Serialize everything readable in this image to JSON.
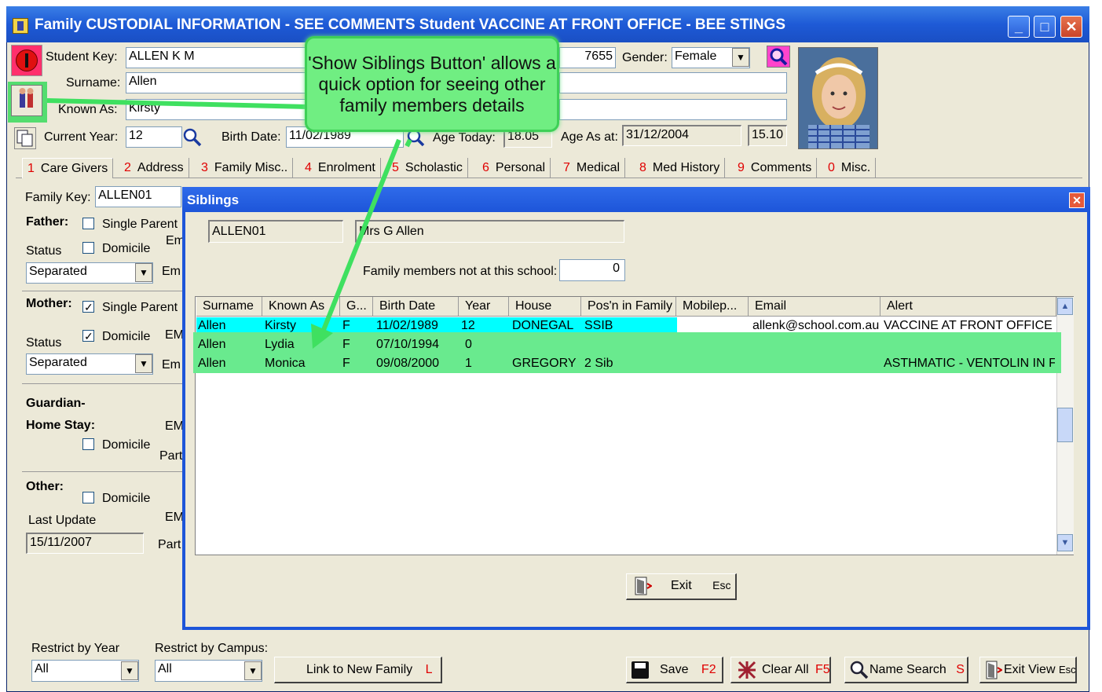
{
  "window": {
    "title": "Family CUSTODIAL INFORMATION - SEE COMMENTS Student VACCINE AT FRONT OFFICE - BEE STINGS",
    "minimize": "_",
    "maximize": "□",
    "close": "✕"
  },
  "student": {
    "student_key_label": "Student Key:",
    "student_key": "ALLEN K M",
    "id_number": "7655",
    "gender_label": "Gender:",
    "gender": "Female",
    "surname_label": "Surname:",
    "surname": "Allen",
    "known_as_label": "Known As:",
    "known_as": "Kirsty",
    "current_year_label": "Current Year:",
    "current_year": "12",
    "birth_date_label": "Birth Date:",
    "birth_date": "11/02/1989",
    "age_today_label": "Age Today:",
    "age_today": "18.05",
    "age_as_at_label": "Age As at:",
    "age_as_at_date": "31/12/2004",
    "age_as_at": "15.10"
  },
  "callout": {
    "text": "'Show Siblings Button' allows a quick option for seeing other family members details"
  },
  "tabs": [
    {
      "num": "1",
      "label": "Care Givers"
    },
    {
      "num": "2",
      "label": "Address"
    },
    {
      "num": "3",
      "label": "Family Misc.."
    },
    {
      "num": "4",
      "label": "Enrolment"
    },
    {
      "num": "5",
      "label": "Scholastic"
    },
    {
      "num": "6",
      "label": "Personal"
    },
    {
      "num": "7",
      "label": "Medical"
    },
    {
      "num": "8",
      "label": "Med History"
    },
    {
      "num": "9",
      "label": "Comments"
    },
    {
      "num": "0",
      "label": "Misc."
    }
  ],
  "left_panel": {
    "family_key_label": "Family Key:",
    "family_key": "ALLEN01",
    "father_label": "Father:",
    "single_parent_label": "Single Parent",
    "domicile_label": "Domicile",
    "status_label": "Status",
    "father_status": "Separated",
    "mother_label": "Mother:",
    "mother_status": "Separated",
    "guardian_label": "Guardian-",
    "home_stay_label": "Home Stay:",
    "other_label": "Other:",
    "last_update_label": "Last Update",
    "last_update": "15/11/2007",
    "em_label": "Em",
    "em_upper": "EM",
    "part_label": "Part"
  },
  "siblings": {
    "title": "Siblings",
    "family_key": "ALLEN01",
    "family_name": "Mrs G Allen",
    "not_at_school_label": "Family members not at this school:",
    "not_at_school": "0",
    "columns": [
      "Surname",
      "Known As",
      "G...",
      "Birth Date",
      "Year",
      "House",
      "Pos'n in Family",
      "Mobilep...",
      "Email",
      "Alert"
    ],
    "rows": [
      {
        "surname": "Allen",
        "known_as": "Kirsty",
        "g": "F",
        "birth_date": "11/02/1989",
        "year": "12",
        "house": "DONEGAL",
        "posn": "SSIB",
        "mobile": "",
        "email": "allenk@school.com.au",
        "alert": "VACCINE AT FRONT OFFICE"
      },
      {
        "surname": "Allen",
        "known_as": "Lydia",
        "g": "F",
        "birth_date": "07/10/1994",
        "year": "0",
        "house": "",
        "posn": "",
        "mobile": "",
        "email": "",
        "alert": ""
      },
      {
        "surname": "Allen",
        "known_as": "Monica",
        "g": "F",
        "birth_date": "09/08/2000",
        "year": "1",
        "house": "GREGORY",
        "posn": "2 Sib",
        "mobile": "",
        "email": "",
        "alert": "ASTHMATIC - VENTOLIN IN F"
      }
    ],
    "exit_label": "Exit",
    "exit_shortcut": "Esc"
  },
  "footer": {
    "restrict_year_label": "Restrict by Year",
    "restrict_year": "All",
    "restrict_campus_label": "Restrict by Campus:",
    "restrict_campus": "All",
    "link_family_label": "Link to New Family",
    "link_family_shortcut": "L",
    "save_label": "Save",
    "save_shortcut": "F2",
    "clear_all_label": "Clear All",
    "clear_all_shortcut": "F5",
    "name_search_label": "Name Search",
    "name_search_shortcut": "S",
    "exit_view_label": "Exit View",
    "exit_view_shortcut": "Esc"
  },
  "colors": {
    "title_blue": "#1e5ad6",
    "callout_green": "#70ee82",
    "row_selected": "#00ffff",
    "row_highlight": "#69ea8e",
    "shortcut_red": "#e00000"
  }
}
